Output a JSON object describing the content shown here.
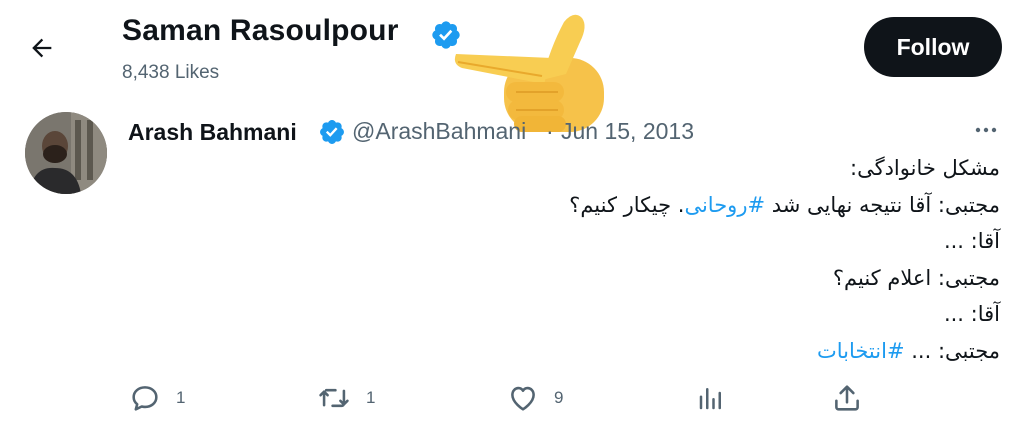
{
  "header": {
    "profile_name": "Saman Rasoulpour",
    "likes_count": "8,438 Likes",
    "follow_label": "Follow"
  },
  "tweet": {
    "author_name": "Arash Bahmani",
    "handle": "@ArashBahmani",
    "separator": "·",
    "date": "Jun 15, 2013",
    "lines": [
      {
        "text": "مشکل خانوادگی:"
      },
      {
        "pre": "مجتبی: آقا نتیجه نهایی شد ",
        "tag": "#روحانی",
        "post": ". چیکار کنیم؟"
      },
      {
        "text": "آقا: ..."
      },
      {
        "text": "مجتبی: اعلام کنیم؟"
      },
      {
        "text": "آقا: ..."
      },
      {
        "pre": "مجتبی: ... ",
        "tag": "#انتخابات",
        "post": ""
      }
    ]
  },
  "actions": {
    "reply_count": "1",
    "retweet_count": "1",
    "like_count": "9"
  },
  "colors": {
    "accent": "#1d9bf0",
    "text": "#0f1419",
    "muted": "#536471",
    "follow_bg": "#0f1419"
  }
}
